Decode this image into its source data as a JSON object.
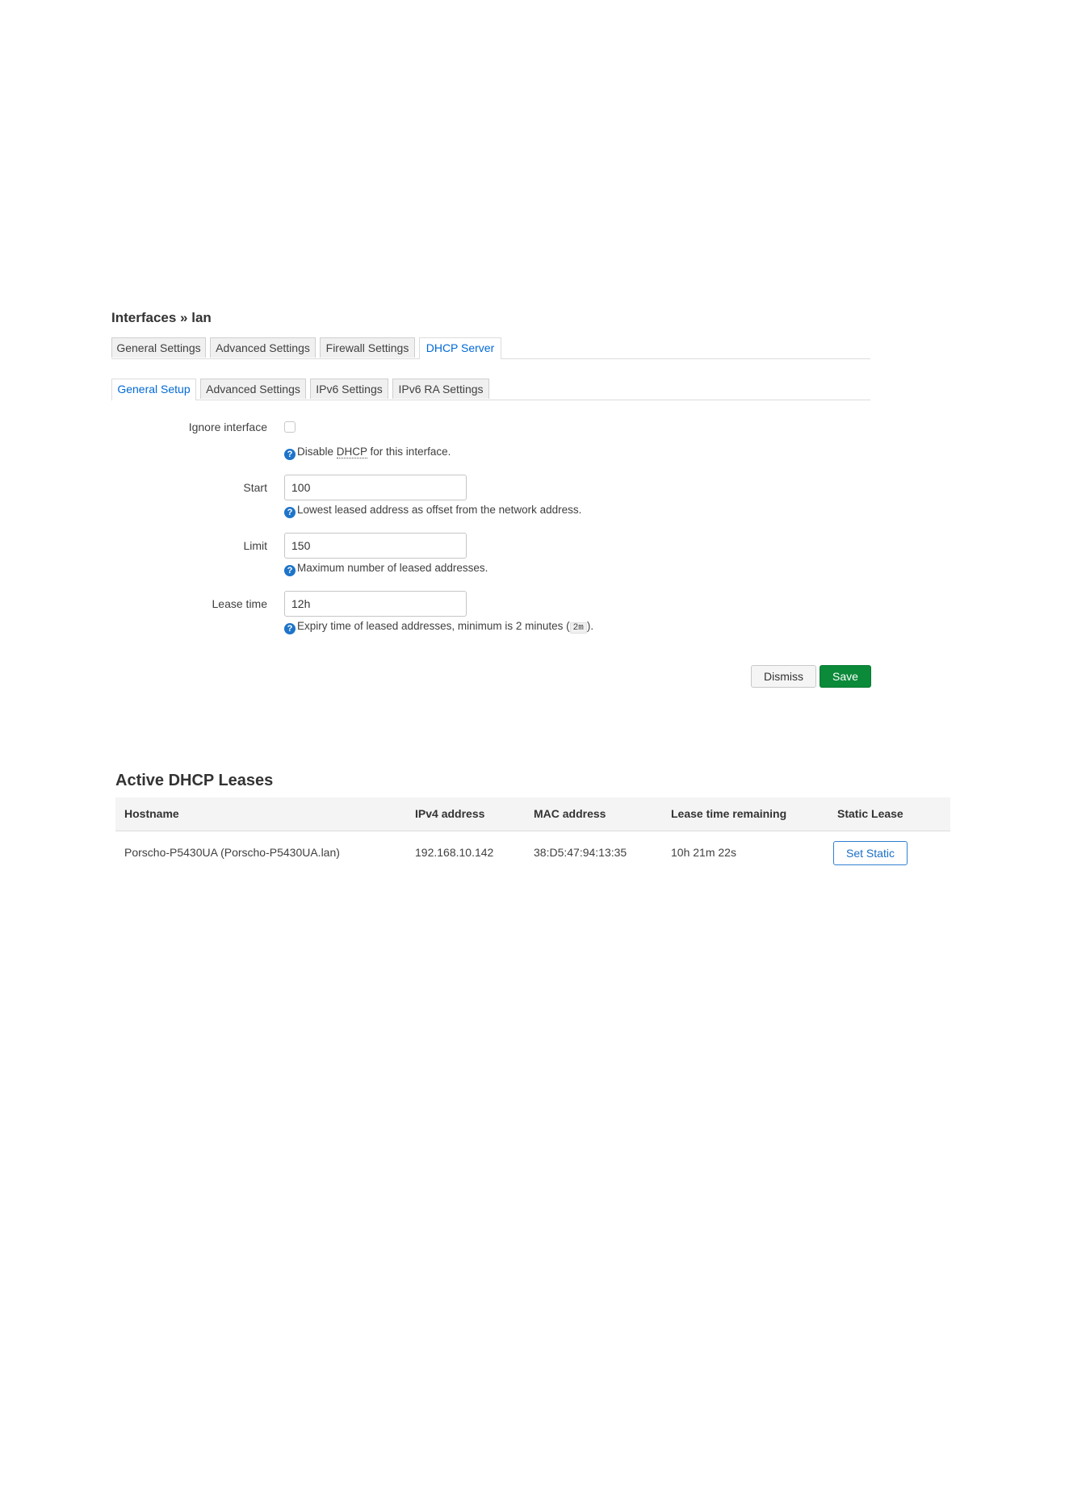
{
  "page_title": "Interfaces » lan",
  "top_tabs": [
    "General Settings",
    "Advanced Settings",
    "Firewall Settings",
    "DHCP Server"
  ],
  "sub_tabs": [
    "General Setup",
    "Advanced Settings",
    "IPv6 Settings",
    "IPv6 RA Settings"
  ],
  "form": {
    "ignore_interface": {
      "label": "Ignore interface",
      "checked": false,
      "help_before": "Disable ",
      "help_abbr": "DHCP",
      "help_after": " for this interface."
    },
    "start": {
      "label": "Start",
      "value": "100",
      "help": "Lowest leased address as offset from the network address."
    },
    "limit": {
      "label": "Limit",
      "value": "150",
      "help": "Maximum number of leased addresses."
    },
    "lease_time": {
      "label": "Lease time",
      "value": "12h",
      "help_before": "Expiry time of leased addresses, minimum is 2 minutes (",
      "help_code": "2m",
      "help_after": ")."
    },
    "help_icon_glyph": "?"
  },
  "buttons": {
    "dismiss": "Dismiss",
    "save": "Save"
  },
  "leases": {
    "title": "Active DHCP Leases",
    "columns": [
      "Hostname",
      "IPv4 address",
      "MAC address",
      "Lease time remaining",
      "Static Lease"
    ],
    "rows": [
      {
        "hostname": "Porscho-P5430UA (Porscho-P5430UA.lan)",
        "ipv4": "192.168.10.142",
        "mac": "38:D5:47:94:13:35",
        "remaining": "10h 21m 22s",
        "action": "Set Static"
      }
    ]
  },
  "colors": {
    "accent": "#0069d6",
    "save": "#0b8a3a",
    "help_icon": "#1e74c9"
  }
}
